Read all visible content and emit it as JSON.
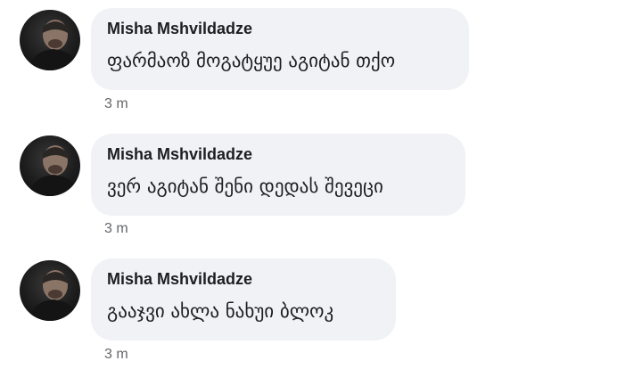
{
  "comments": [
    {
      "author": "Misha Mshvildadze",
      "text": "ფარმაოზ მოგატყუე აგიტან თქო",
      "time": "3 m"
    },
    {
      "author": "Misha Mshvildadze",
      "text": "ვერ აგიტან შენი დედას შევეცი",
      "time": "3 m"
    },
    {
      "author": "Misha Mshvildadze",
      "text": "გააჯვი ახლა ნახუი ბლოკ",
      "time": "3 m"
    }
  ]
}
